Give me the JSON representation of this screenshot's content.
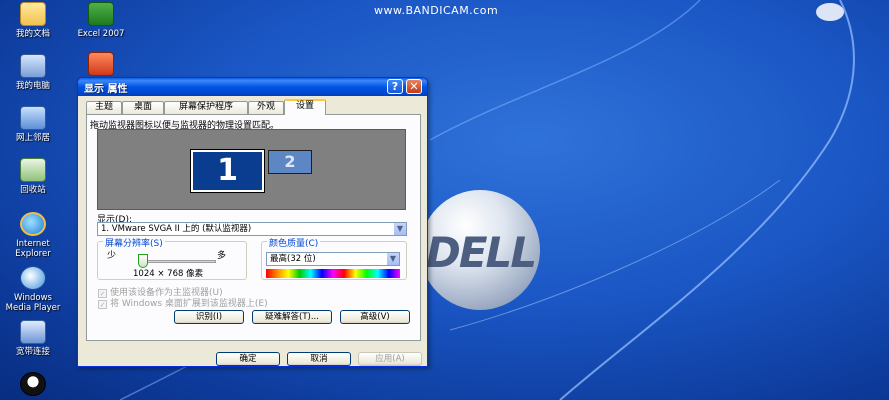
{
  "watermark": "www.BANDICAM.com",
  "desktop_icons": [
    {
      "label": "我的文档"
    },
    {
      "label": "Excel 2007"
    },
    {
      "label": "我的电脑"
    },
    {
      "label": "网上邻居"
    },
    {
      "label": "回收站"
    },
    {
      "label": "Internet Explorer"
    },
    {
      "label": "Windows Media Player"
    },
    {
      "label": "宽带连接"
    }
  ],
  "dialog": {
    "title": "显示 属性",
    "help_symbol": "?",
    "close_symbol": "✕",
    "tabs": [
      "主题",
      "桌面",
      "屏幕保护程序",
      "外观",
      "设置"
    ],
    "active_tab": "设置",
    "instruction": "拖动监视器图标以便与监视器的物理设置匹配。",
    "monitors": [
      "1",
      "2"
    ],
    "display_label": "显示(D):",
    "display_value": "1. VMware SVGA II 上的 (默认监视器)",
    "resolution": {
      "title": "屏幕分辨率(S)",
      "less": "少",
      "more": "多",
      "value": "1024 × 768 像素",
      "slider_position_percent": 0
    },
    "color_quality": {
      "title": "颜色质量(C)",
      "value": "最高(32 位)"
    },
    "checkbox_primary": "使用该设备作为主监视器(U)",
    "checkbox_extend": "将 Windows 桌面扩展到该监视器上(E)",
    "buttons": {
      "identify": "识别(I)",
      "troubleshoot": "疑难解答(T)...",
      "advanced": "高级(V)",
      "ok": "确定",
      "cancel": "取消",
      "apply": "应用(A)"
    }
  },
  "dell_logo_text": "DELL",
  "colors": {
    "xp_blue_title": "#0054e3",
    "tab_highlight": "#ffc83c",
    "group_title": "#0046d5"
  }
}
